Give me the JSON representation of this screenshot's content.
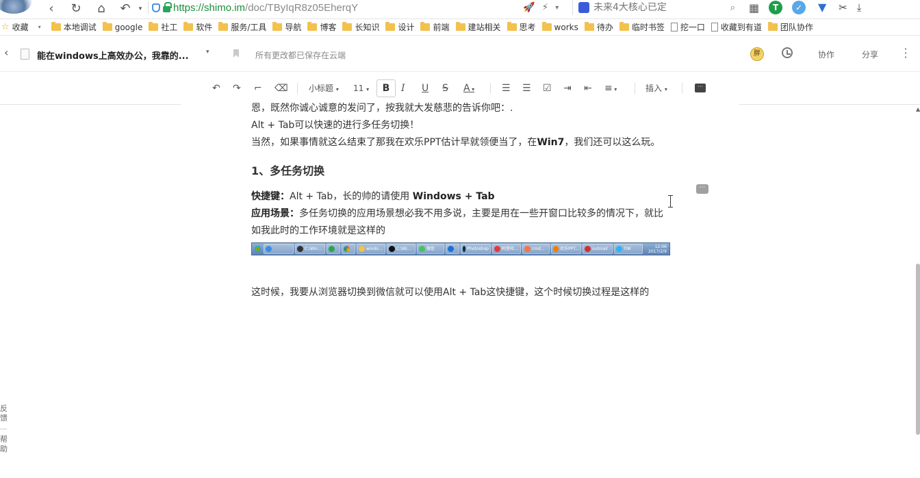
{
  "browser": {
    "url_host": "https://shimo.im",
    "url_path": "/doc/TByIqR8z05EherqY",
    "search_placeholder": "未来4大核心已定"
  },
  "bookmarks": {
    "favorites": "收藏",
    "items": [
      "本地调试",
      "google",
      "社工",
      "软件",
      "服务/工具",
      "导航",
      "博客",
      "长知识",
      "设计",
      "前端",
      "建站相关",
      "思考",
      "works",
      "待办",
      "临时书签"
    ],
    "pages": [
      "挖一口",
      "收藏到有道"
    ],
    "last": "团队协作"
  },
  "doc": {
    "title": "能在windows上高效办公，我靠的...",
    "save_status": "所有更改都已保存在云端",
    "user_badge": "胖",
    "collab": "协作",
    "share": "分享"
  },
  "toolbar": {
    "heading_style": "小标题",
    "font_size": "11",
    "bold": "B",
    "italic": "I",
    "underline": "U",
    "strike": "S",
    "font_color": "A",
    "insert": "插入"
  },
  "content": {
    "p1": "恩，既然你诚心诚意的发问了，按我就大发慈悲的告诉你吧：.",
    "p2": "Alt + Tab可以快速的进行多任务切换！",
    "p3a": "当然，如果事情就这么结束了那我在欢乐PPT估计早就领便当了，在",
    "p3b": "Win7",
    "p3c": "，我们还可以这么玩。",
    "h1": "1、多任务切换",
    "shortcut_label": "快捷键：",
    "shortcut_text": "Alt + Tab，长的帅的请使用 ",
    "shortcut_bold": "Windows + Tab",
    "scene_label": "应用场景：",
    "scene_text": "多任务切换的应用场景想必我不用多说，主要是用在一些开窗口比较多的情况下，就比如我此时的工作环境就是这样的",
    "p_last": "这时候，我要从浏览器切换到微信就可以使用Alt + Tab这快捷键，这个时候切换过程是这样的"
  },
  "taskbar": {
    "items": [
      "",
      "",
      "C:\\Win...",
      "",
      "",
      "windo...",
      "C:\\Wi...",
      "微信",
      "",
      "Photoshop",
      "阿里旺...",
      "cmd...",
      "欢乐PPT...",
      "outmail",
      "TIM"
    ],
    "clock": "12:06",
    "date": "2017/2/9"
  },
  "sidebar": {
    "feedback": "反馈",
    "help": "帮助"
  },
  "colors": {
    "url_green": "#1a8d3c",
    "accent_blue": "#3a7bd5",
    "folder_yellow": "#f2c14e"
  }
}
